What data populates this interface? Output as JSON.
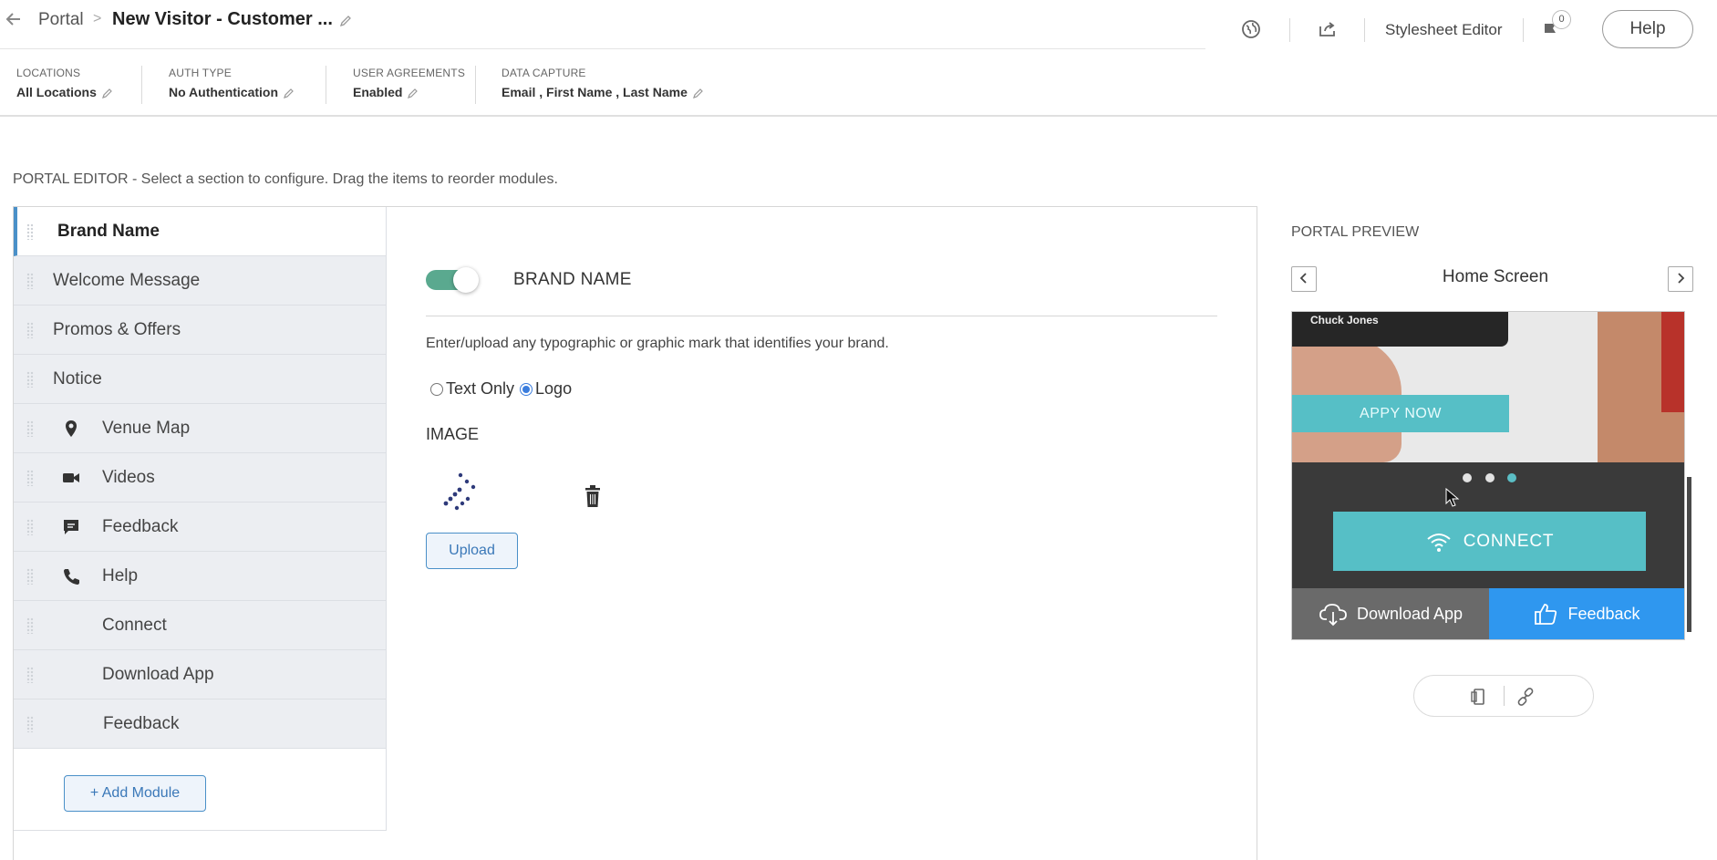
{
  "header": {
    "breadcrumb_root": "Portal",
    "breadcrumb_sep": ">",
    "title": "New Visitor - Customer ...",
    "stylesheet_editor": "Stylesheet Editor",
    "notification_count": "0",
    "help": "Help"
  },
  "settings": {
    "locations": {
      "label": "LOCATIONS",
      "value": "All Locations"
    },
    "auth_type": {
      "label": "AUTH TYPE",
      "value": "No Authentication"
    },
    "user_agreements": {
      "label": "USER AGREEMENTS",
      "value": "Enabled"
    },
    "data_capture": {
      "label": "DATA CAPTURE",
      "value": "Email , First Name , Last Name"
    }
  },
  "editor": {
    "intro": "PORTAL EDITOR - Select a section to configure. Drag the items to reorder modules.",
    "modules": [
      {
        "label": "Brand Name",
        "icon": "none",
        "active": true
      },
      {
        "label": "Welcome Message",
        "icon": "none"
      },
      {
        "label": "Promos & Offers",
        "icon": "none"
      },
      {
        "label": "Notice",
        "icon": "none"
      },
      {
        "label": "Venue Map",
        "icon": "map-pin-icon"
      },
      {
        "label": "Videos",
        "icon": "video-camera-icon"
      },
      {
        "label": "Feedback",
        "icon": "chat-bubble-icon"
      },
      {
        "label": "Help",
        "icon": "phone-icon"
      },
      {
        "label": "Connect",
        "icon": "none"
      },
      {
        "label": "Download App",
        "icon": "none"
      },
      {
        "label": "Feedback",
        "icon": "none"
      }
    ],
    "add_module": "+ Add Module"
  },
  "config": {
    "toggle_on": true,
    "title": "BRAND NAME",
    "description": "Enter/upload any typographic or graphic mark that identifies your brand.",
    "radio_text_only": "Text Only",
    "radio_logo": "Logo",
    "selected": "Logo",
    "image_label": "IMAGE",
    "upload": "Upload"
  },
  "preview": {
    "label": "PORTAL PREVIEW",
    "screen": "Home Screen",
    "card_name": "Chuck Jones",
    "apply_now": "APPY NOW",
    "connect": "CONNECT",
    "download_app": "Download App",
    "feedback": "Feedback",
    "carousel_active_index": 2,
    "colors": {
      "teal": "#56bfc6",
      "blue": "#2f97ef",
      "dark": "#3a3a3a"
    }
  }
}
